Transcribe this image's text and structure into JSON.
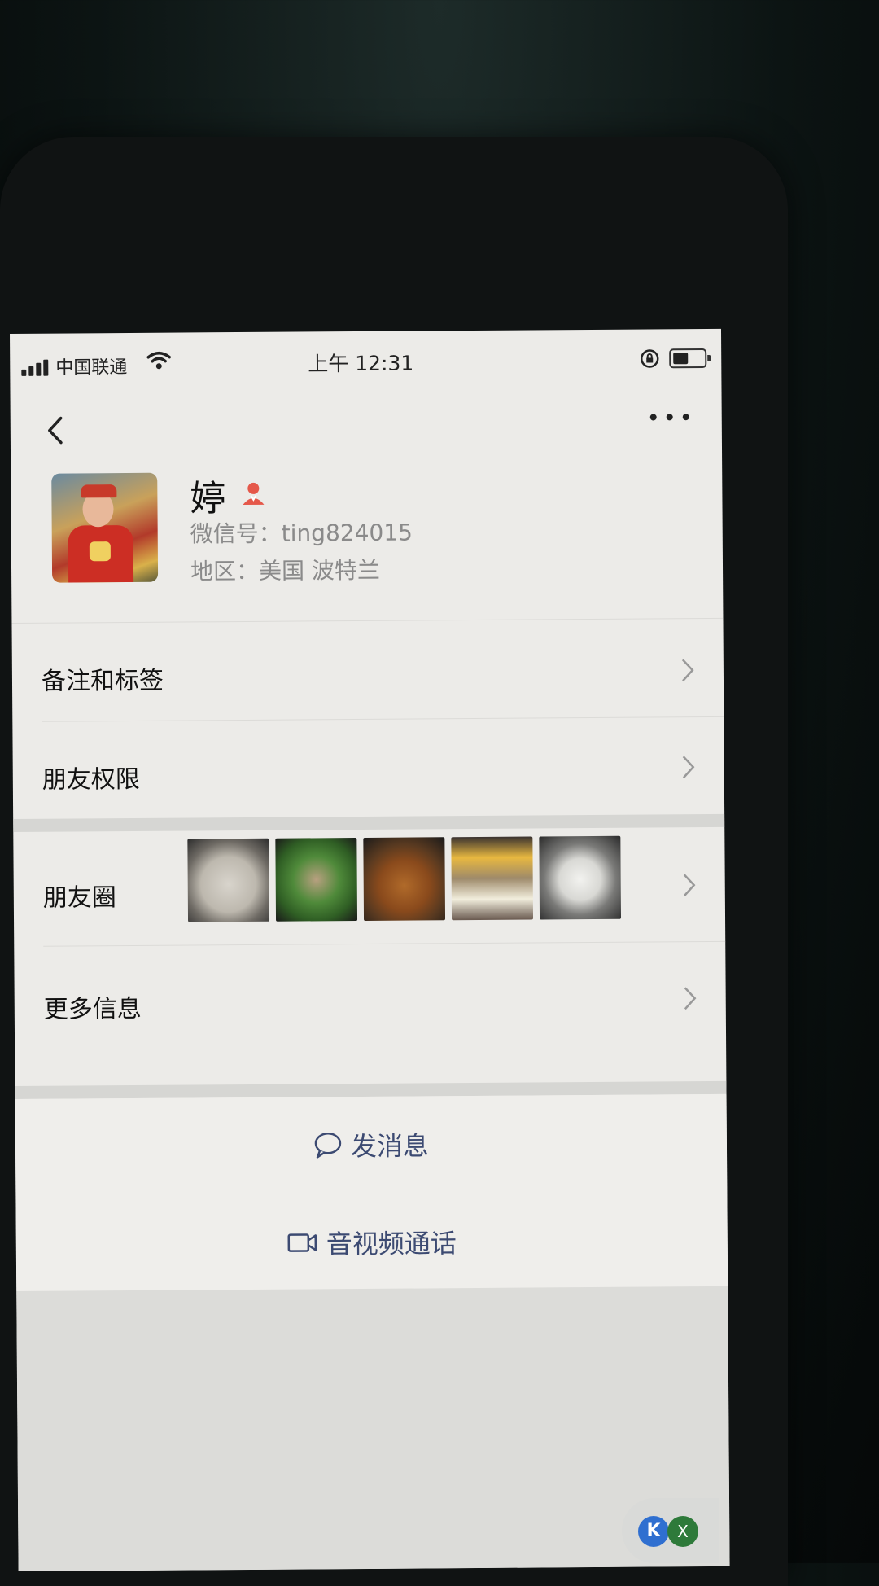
{
  "status_bar": {
    "carrier": "中国联通",
    "time": "上午 12:31"
  },
  "nav": {
    "back_icon": "chevron-left-icon",
    "more_icon": "ellipsis-icon"
  },
  "profile": {
    "name": "婷",
    "wechat_id": "微信号：ting824015",
    "region": "地区：美国 波特兰",
    "gender_icon": "female-person-icon",
    "gender_color": "#e5584a"
  },
  "rows": {
    "remark_tags": "备注和标签",
    "friend_permissions": "朋友权限",
    "moments": "朋友圈",
    "more_info": "更多信息"
  },
  "actions": {
    "send_message": "发消息",
    "video_call": "音视频通话",
    "accent_color": "#3c4a72"
  },
  "floating_badges": {
    "left": "K",
    "right": "X"
  }
}
